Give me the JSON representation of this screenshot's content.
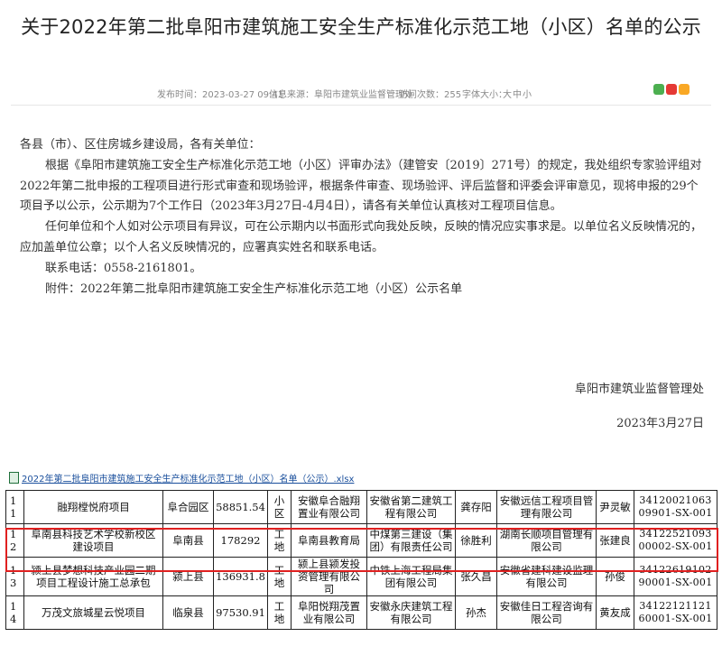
{
  "article": {
    "title": "关于2022年第二批阜阳市建筑施工安全生产标准化示范工地（小区）名单的公示",
    "meta": {
      "published": "发布时间：2023-03-27 09:41",
      "source": "信息来源：阜阳市建筑业监督管理处",
      "views": "访问次数：255",
      "font_size": "字体大小：",
      "font_large": "大",
      "font_medium": "中",
      "font_small": "小"
    },
    "share_icons": [
      "wechat-icon",
      "weibo-icon",
      "qzone-icon"
    ],
    "paragraphs": [
      "各县（市）、区住房城乡建设局，各有关单位：",
      "根据《阜阳市建筑施工安全生产标准化示范工地（小区）评审办法》（建管安〔2019〕271号）的规定，我处组织专家验评组对2022年第二批申报的工程项目进行形式审查和现场验评，根据条件审查、现场验评、评后监督和评委会评审意见，现将申报的29个项目予以公示，公示期为7个工作日（2023年3月27日-4月4日），请各有关单位认真核对工程项目信息。",
      "任何单位和个人如对公示项目有异议，可在公示期内以书面形式向我处反映，反映的情况应实事求是。以单位名义反映情况的，应加盖单位公章；以个人名义反映情况的，应署真实姓名和联系电话。",
      "联系电话：0558-2161801。",
      "附件：2022年第二批阜阳市建筑施工安全生产标准化示范工地（小区）公示名单"
    ],
    "signature": "阜阳市建筑业监督管理处",
    "date": "2023年3月27日",
    "attachment": "2022年第二批阜阳市建筑施工安全生产标准化示范工地（小区）名单（公示）.xlsx"
  },
  "table": {
    "rows": [
      [
        "11",
        "融翔樘悦府项目",
        "阜合园区",
        "58851.54",
        "小区",
        "安徽阜合融翔置业有限公司",
        "安徽省第二建筑工程有限公司",
        "龚存阳",
        "安徽远信工程项目管理有限公司",
        "尹灵敏",
        "3412002106309901-SX-001"
      ],
      [
        "12",
        "阜南县科技艺术学校新校区建设项目",
        "阜南县",
        "178292",
        "工地",
        "阜南县教育局",
        "中煤第三建设（集团）有限责任公司",
        "徐胜利",
        "湖南长顺项目管理有限公司",
        "张建良",
        "3412252109300002-SX-001"
      ],
      [
        "13",
        "颍上县梦想科技产业园二期项目工程设计施工总承包",
        "颍上县",
        "136931.8",
        "工地",
        "颍上县颍发投资管理有限公司",
        "中铁上海工程局集团有限公司",
        "张久昌",
        "安徽省建科建设监理有限公司",
        "孙俊",
        "3412261910290001-SX-001"
      ],
      [
        "14",
        "万茂文旅城星云悦项目",
        "临泉县",
        "97530.91",
        "工地",
        "阜阳悦翔茂置业有限公司",
        "安徽永庆建筑工程有限公司",
        "孙杰",
        "安徽佳日工程咨询有限公司",
        "黄友成",
        "3412212112160001-SX-001"
      ]
    ]
  }
}
